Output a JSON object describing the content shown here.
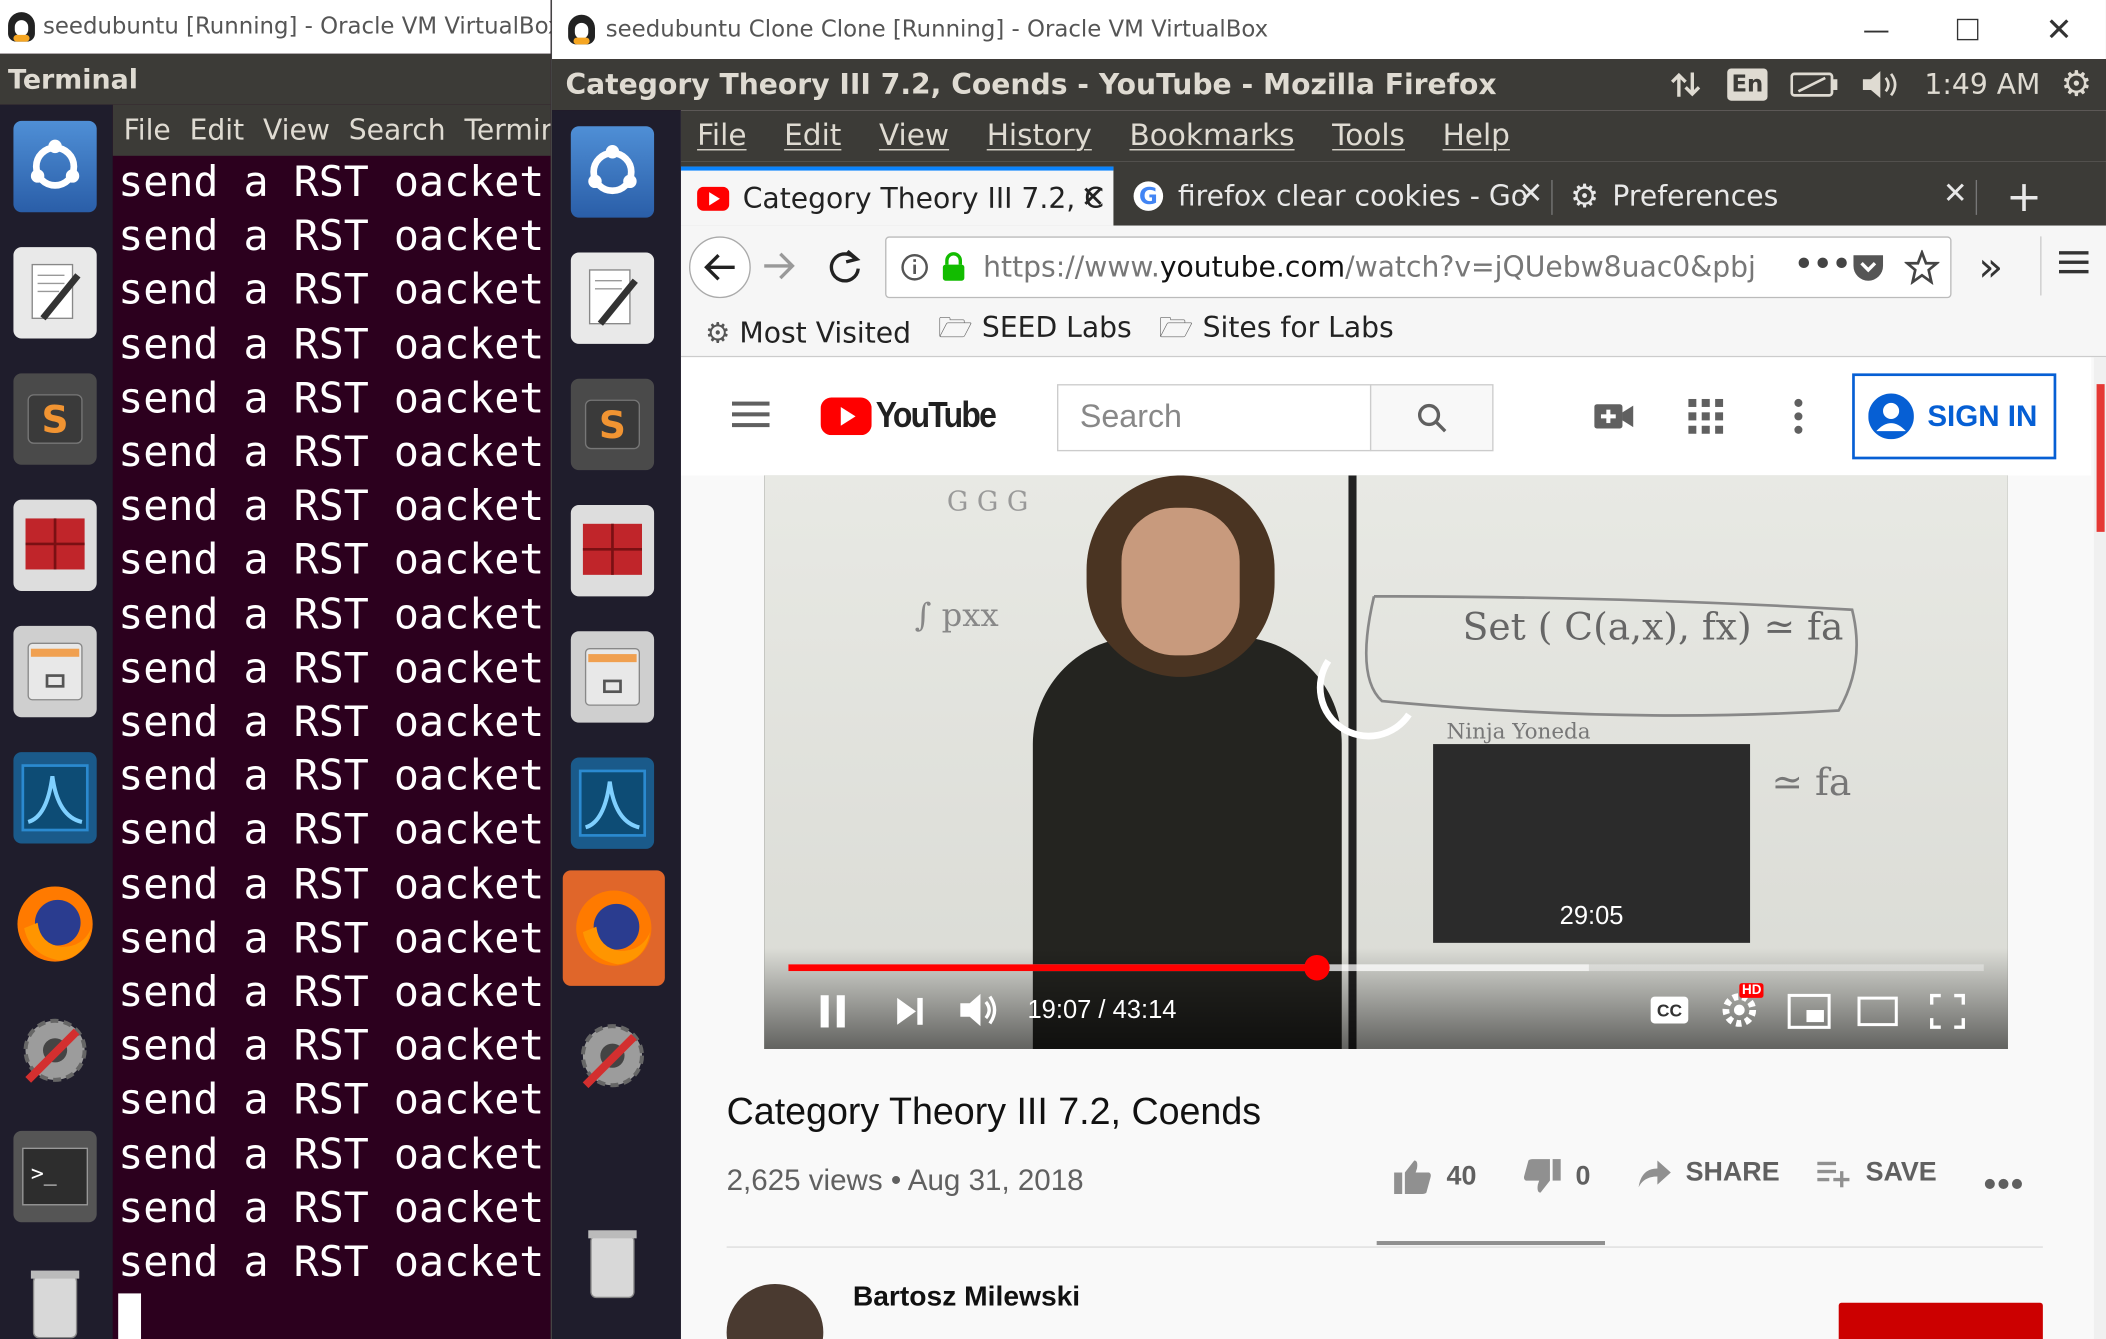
{
  "left_window": {
    "title": "seedubuntu [Running] - Oracle VM VirtualBox",
    "app_name": "Terminal",
    "terminal_menu": [
      "File",
      "Edit",
      "View",
      "Search",
      "Terminal"
    ],
    "terminal_lines": [
      "send a RST oacket",
      "send a RST oacket",
      "send a RST oacket",
      "send a RST oacket",
      "send a RST oacket",
      "send a RST oacket",
      "send a RST oacket",
      "send a RST oacket",
      "send a RST oacket",
      "send a RST oacket",
      "send a RST oacket",
      "send a RST oacket",
      "send a RST oacket",
      "send a RST oacket",
      "send a RST oacket",
      "send a RST oacket",
      "send a RST oacket",
      "send a RST oacket",
      "send a RST oacket",
      "send a RST oacket",
      "send a RST oacket"
    ]
  },
  "right_window": {
    "title": "seedubuntu Clone Clone [Running] - Oracle VM VirtualBox",
    "firefox_title": "Category Theory III 7.2, Coends - YouTube - Mozilla Firefox",
    "indicators": {
      "keyboard": "En",
      "time": "1:49 AM"
    },
    "menu": [
      "File",
      "Edit",
      "View",
      "History",
      "Bookmarks",
      "Tools",
      "Help"
    ],
    "tabs": [
      {
        "label": "Category Theory III 7.2, C"
      },
      {
        "label": "firefox clear cookies - Go"
      },
      {
        "label": "Preferences"
      }
    ],
    "url": {
      "prefix": "https://www.",
      "domain": "youtube.com",
      "path": "/watch?v=jQUebw8uac0&pbj"
    },
    "bookmarks": [
      "Most Visited",
      "SEED Labs",
      "Sites for Labs"
    ]
  },
  "youtube": {
    "logo_text": "YouTube",
    "search_placeholder": "Search",
    "sign_in": "SIGN IN",
    "video": {
      "current_time": "19:07",
      "duration": "43:14",
      "time_display": "19:07 / 43:14",
      "progress_fraction": 0.442,
      "buffered_fraction": 0.67,
      "hover_preview_time": "29:05",
      "hd_badge": "HD",
      "cc_label": "CC"
    },
    "title": "Category Theory III 7.2, Coends",
    "views": "2,625 views",
    "date": "Aug 31, 2018",
    "stats_line": "2,625 views • Aug 31, 2018",
    "likes": "40",
    "dislikes": "0",
    "share": "SHARE",
    "save": "SAVE",
    "channel": "Bartosz Milewski"
  },
  "colors": {
    "youtube_red": "#ff0000",
    "ubuntu_bg": "#2c001e",
    "panel": "#3c3b37",
    "sign_in_blue": "#065fd4"
  }
}
